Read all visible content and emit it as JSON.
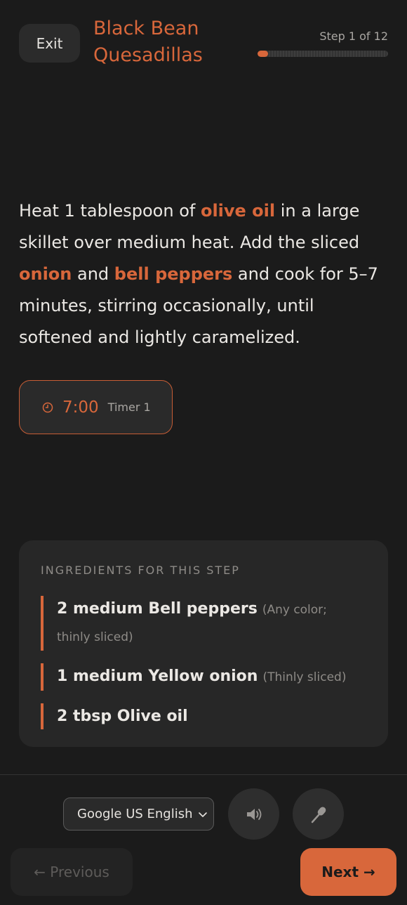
{
  "header": {
    "exit_label": "Exit",
    "recipe_title": "Black Bean Quesadillas",
    "step_label": "Step 1 of 12",
    "progress_fraction": 0.0833
  },
  "step": {
    "instruction_parts": [
      {
        "text": "Heat 1 tablespoon of ",
        "highlight": false
      },
      {
        "text": "olive oil",
        "highlight": true
      },
      {
        "text": " in a large skillet over medium heat. Add the sliced ",
        "highlight": false
      },
      {
        "text": "onion",
        "highlight": true
      },
      {
        "text": " and ",
        "highlight": false
      },
      {
        "text": "bell peppers",
        "highlight": true
      },
      {
        "text": " and cook for 5–7 minutes, stirring occasionally, until softened and lightly caramelized.",
        "highlight": false
      }
    ],
    "timer": {
      "time": "7:00",
      "label": "Timer 1",
      "icon": "clock-icon"
    }
  },
  "ingredients": {
    "heading": "INGREDIENTS FOR THIS STEP",
    "items": [
      {
        "name": "2 medium Bell peppers",
        "note": "(Any color; thinly sliced)"
      },
      {
        "name": "1 medium Yellow onion",
        "note": "(Thinly sliced)"
      },
      {
        "name": "2 tbsp Olive oil",
        "note": ""
      }
    ]
  },
  "controls": {
    "voice_selected": "Google US English",
    "speaker_icon": "speaker-icon",
    "mic_icon": "microphone-icon",
    "previous_label": "← Previous",
    "next_label": "Next →"
  },
  "colors": {
    "accent": "#d8673b",
    "background": "#1b1b1b",
    "card": "#272727"
  }
}
